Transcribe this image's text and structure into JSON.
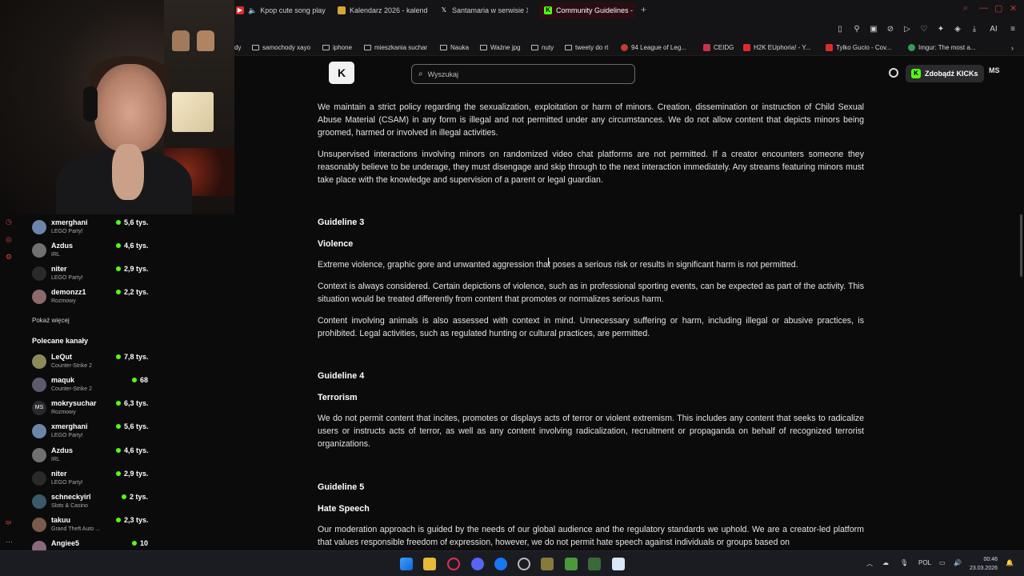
{
  "browser": {
    "tabs": [
      {
        "label": "Kpop cute song playli"
      },
      {
        "label": "Kalendarz 2026 - kalenda"
      },
      {
        "label": "Santamaria w serwisie X:"
      },
      {
        "label": "Community Guidelines - K"
      }
    ],
    "bookmarks": [
      {
        "label": "dy"
      },
      {
        "label": "samochody xayo"
      },
      {
        "label": "iphone"
      },
      {
        "label": "mieszkania suchar"
      },
      {
        "label": "Nauka"
      },
      {
        "label": "Ważne jpg"
      },
      {
        "label": "nuty"
      },
      {
        "label": "tweety do rt"
      },
      {
        "label": "94 League of Leg..."
      },
      {
        "label": "CEIDG"
      },
      {
        "label": "H2K EUphoria! - Y..."
      },
      {
        "label": "Tylko Gucio - Cov..."
      },
      {
        "label": "Imgur: The most a..."
      }
    ],
    "toolbar_ai": "AI"
  },
  "header": {
    "logo_text": "K",
    "search_placeholder": "Wyszukaj",
    "get_kicks_label": "Zdobądź KICKs",
    "avatar_initials": "MS"
  },
  "sidebar": {
    "followed": [
      {
        "name": "xmerghani",
        "category": "LEGO Party!",
        "viewers": "5,6 tys."
      },
      {
        "name": "Azdus",
        "category": "IRL",
        "viewers": "4,6 tys."
      },
      {
        "name": "niter",
        "category": "LEGO Party!",
        "viewers": "2,9 tys."
      },
      {
        "name": "demonzz1",
        "category": "Rozmowy",
        "viewers": "2,2 tys."
      }
    ],
    "show_more": "Pokaż więcej",
    "recommended_title": "Polecane kanały",
    "recommended": [
      {
        "name": "LeQut",
        "category": "Counter-Strike 2",
        "viewers": "7,8 tys."
      },
      {
        "name": "maquk",
        "category": "Counter-Strike 2",
        "viewers": "68"
      },
      {
        "name": "mokrysuchar",
        "category": "Rozmowy",
        "viewers": "6,3 tys.",
        "initials": "MS"
      },
      {
        "name": "xmerghani",
        "category": "LEGO Party!",
        "viewers": "5,6 tys."
      },
      {
        "name": "Azdus",
        "category": "IRL",
        "viewers": "4,6 tys."
      },
      {
        "name": "niter",
        "category": "LEGO Party!",
        "viewers": "2,9 tys."
      },
      {
        "name": "schneckyirl",
        "category": "Slots & Casino",
        "viewers": "2 tys."
      },
      {
        "name": "takuu",
        "category": "Grand Theft Auto ...",
        "viewers": "2,3 tys."
      },
      {
        "name": "Angiee5",
        "category": "",
        "viewers": "10"
      }
    ],
    "rail_label": "qx"
  },
  "content": {
    "p1": "We maintain a strict policy regarding the sexualization, exploitation or harm of minors. Creation, dissemination or instruction of Child Sexual Abuse Material (CSAM) in any form is illegal and not permitted under any circumstances. We do not allow content that depicts minors being groomed, harmed or involved in illegal activities.",
    "p2": "Unsupervised interactions involving minors on randomized video chat platforms are not permitted. If a creator encounters someone they reasonably believe to be underage, they must disengage and skip through to the next interaction immediately. Any streams featuring minors must take place with the knowledge and supervision of a parent or legal guardian.",
    "g3_label": "Guideline 3",
    "g3_title": "Violence",
    "g3_p1": "Extreme violence, graphic gore and unwanted aggression that poses a serious risk or results in significant harm is not permitted.",
    "g3_p2": "Context is always considered. Certain depictions of violence, such as in professional sporting events, can be expected as part of the activity. This situation would be treated differently from content that promotes or normalizes serious harm.",
    "g3_p3": "Content involving animals is also assessed with context in mind. Unnecessary suffering or harm, including illegal or abusive practices, is prohibited. Legal activities, such as regulated hunting or cultural practices, are permitted.",
    "g4_label": "Guideline 4",
    "g4_title": "Terrorism",
    "g4_p1": "We do not permit content that incites, promotes or displays acts of terror or violent extremism. This includes any content that seeks to radicalize users or instructs acts of terror, as well as any content involving radicalization, recruitment or propaganda on behalf of recognized terrorist organizations.",
    "g5_label": "Guideline 5",
    "g5_title": "Hate Speech",
    "g5_p1": "Our moderation approach is guided by the needs of our global audience and the regulatory standards we uphold. We are a creator-led platform that values responsible freedom of expression, however, we do not permit hate speech against individuals or groups based on"
  },
  "taskbar": {
    "lang": "POL",
    "time": "00:46",
    "date": "23.03.2026"
  },
  "colors": {
    "kick_green": "#53fc18",
    "background": "#0b0b0c"
  }
}
